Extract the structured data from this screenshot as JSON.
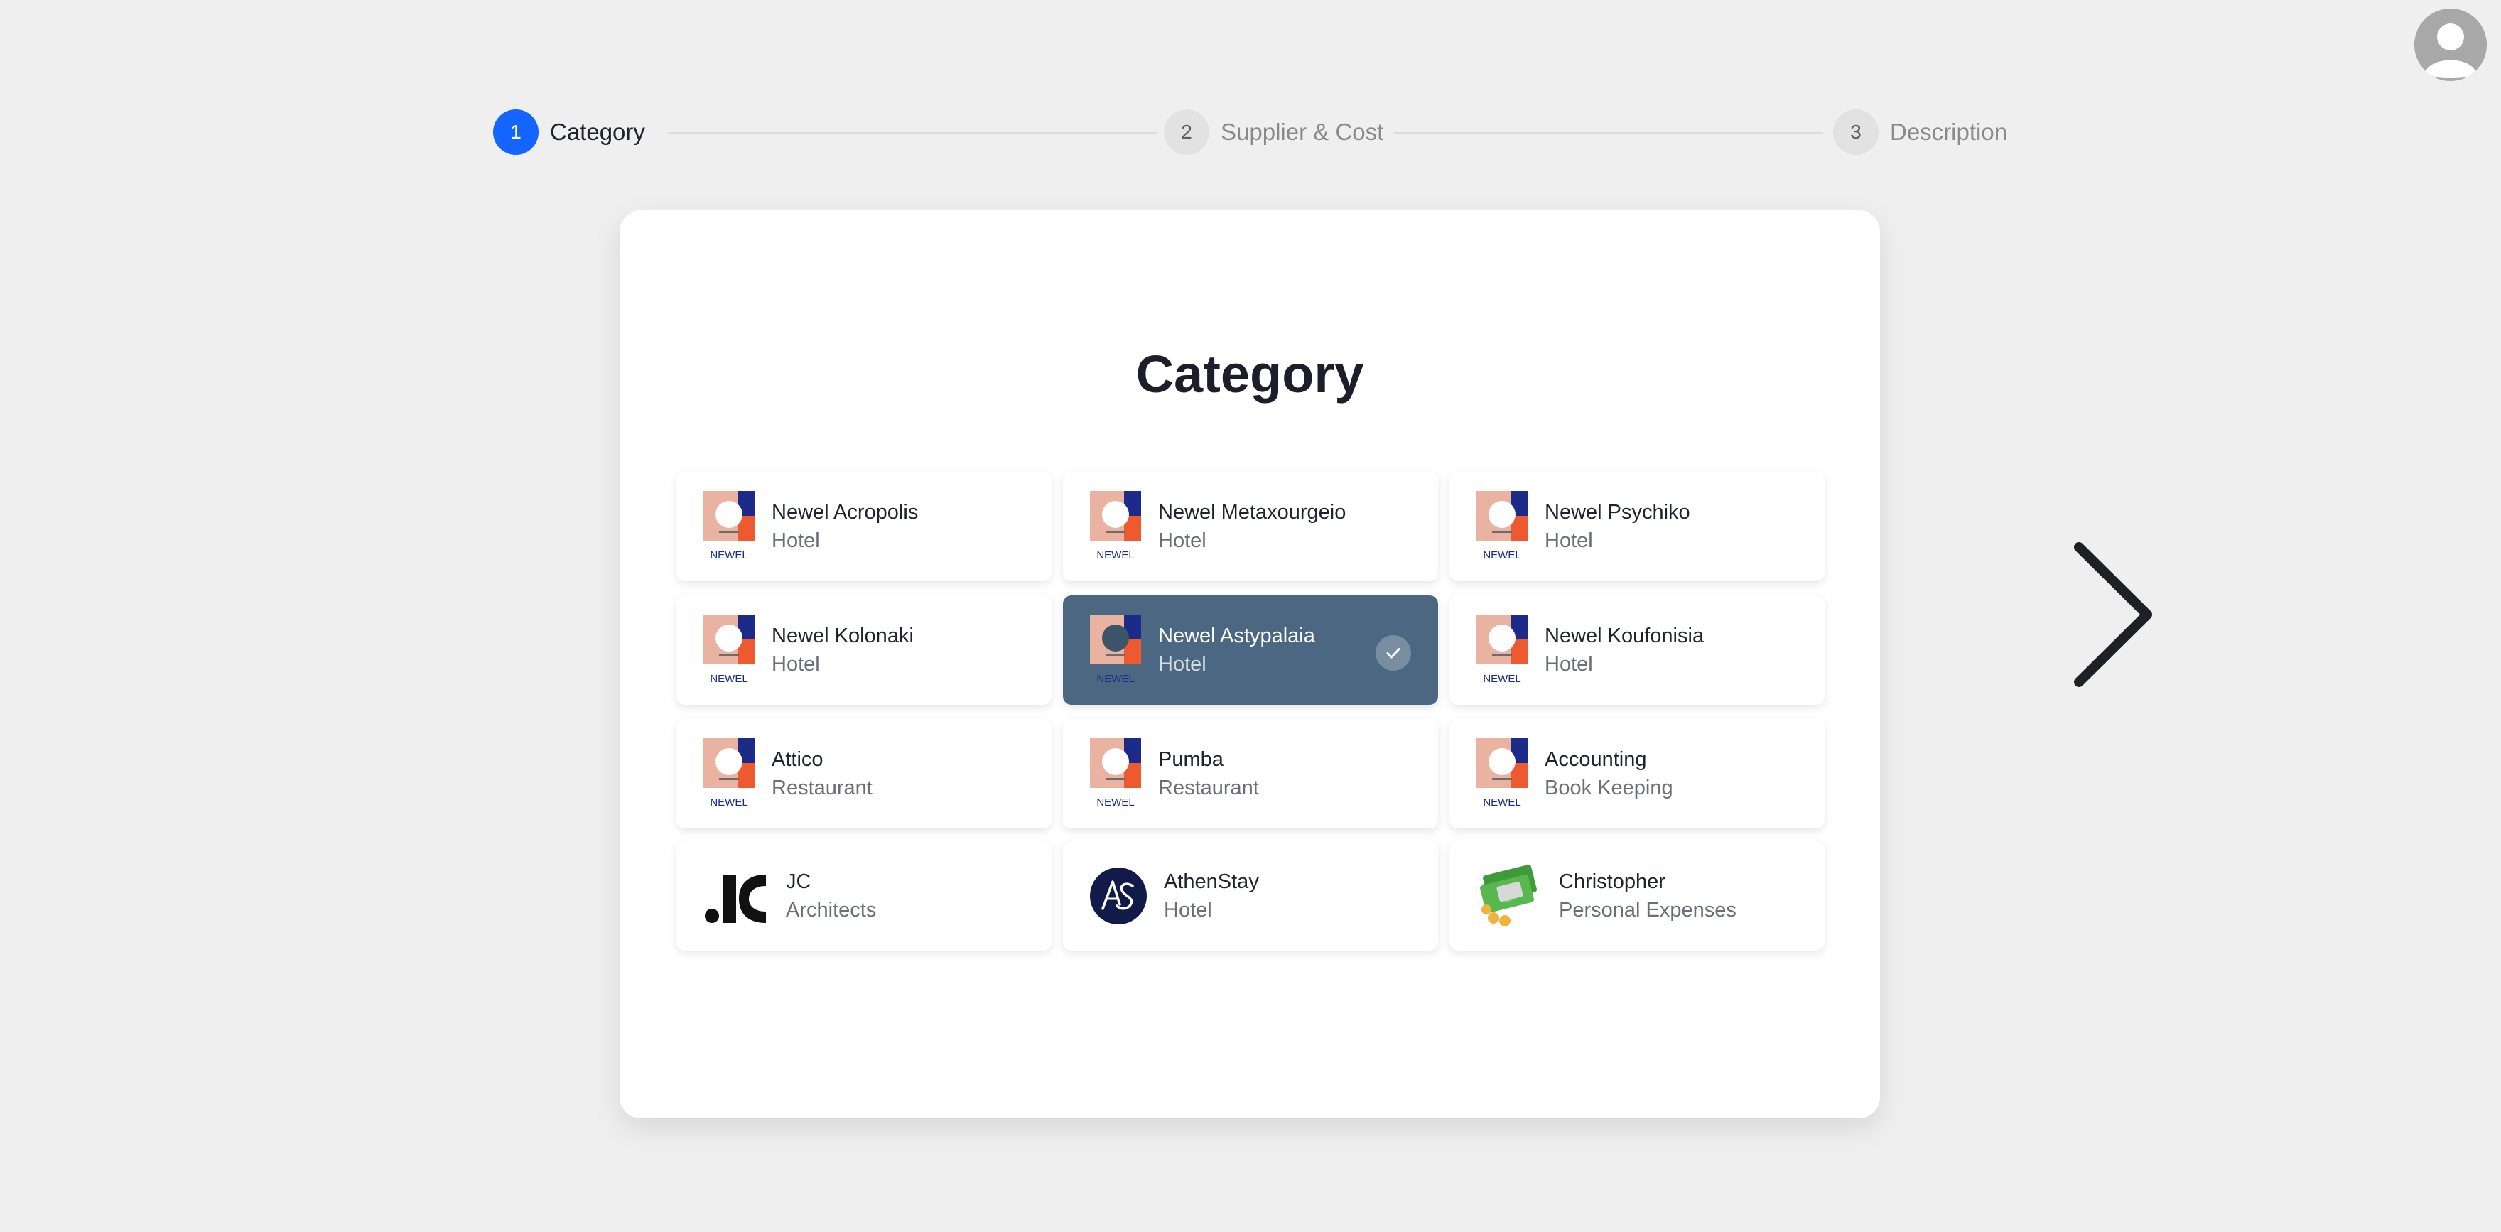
{
  "stepper": {
    "steps": [
      {
        "number": "1",
        "label": "Category",
        "active": true
      },
      {
        "number": "2",
        "label": "Supplier & Cost",
        "active": false
      },
      {
        "number": "3",
        "label": "Description",
        "active": false
      }
    ]
  },
  "card": {
    "title": "Category",
    "items": [
      {
        "name": "Newel Acropolis",
        "subtitle": "Hotel",
        "logo": "newel-logo",
        "logo_text": "NEWEL",
        "selected": false
      },
      {
        "name": "Newel Metaxourgeio",
        "subtitle": "Hotel",
        "logo": "newel-logo",
        "logo_text": "NEWEL",
        "selected": false
      },
      {
        "name": "Newel Psychiko",
        "subtitle": "Hotel",
        "logo": "newel-logo",
        "logo_text": "NEWEL",
        "selected": false
      },
      {
        "name": "Newel Kolonaki",
        "subtitle": "Hotel",
        "logo": "newel-logo",
        "logo_text": "NEWEL",
        "selected": false
      },
      {
        "name": "Newel Astypalaia",
        "subtitle": "Hotel",
        "logo": "newel-logo",
        "logo_text": "NEWEL",
        "selected": true
      },
      {
        "name": "Newel Koufonisia",
        "subtitle": "Hotel",
        "logo": "newel-logo",
        "logo_text": "NEWEL",
        "selected": false
      },
      {
        "name": "Attico",
        "subtitle": "Restaurant",
        "logo": "newel-logo",
        "logo_text": "NEWEL",
        "selected": false
      },
      {
        "name": "Pumba",
        "subtitle": "Restaurant",
        "logo": "newel-logo",
        "logo_text": "NEWEL",
        "selected": false
      },
      {
        "name": "Accounting",
        "subtitle": "Book Keeping",
        "logo": "newel-logo",
        "logo_text": "NEWEL",
        "selected": false
      },
      {
        "name": "JC",
        "subtitle": "Architects",
        "logo": "jc-logo",
        "selected": false
      },
      {
        "name": "AthenStay",
        "subtitle": "Hotel",
        "logo": "athenstay-logo",
        "selected": false
      },
      {
        "name": "Christopher",
        "subtitle": "Personal Expenses",
        "logo": "money-icon",
        "selected": false
      }
    ]
  },
  "icons": {
    "avatar": "user-avatar-icon",
    "next": "chevron-right-icon",
    "check": "check-icon"
  },
  "colors": {
    "accent": "#1465ff",
    "selected_tile": "#4c6781",
    "background": "#efefef",
    "newel_peach": "#eab3a1",
    "newel_navy": "#1c2a8a",
    "newel_orange": "#ee5a2f"
  }
}
